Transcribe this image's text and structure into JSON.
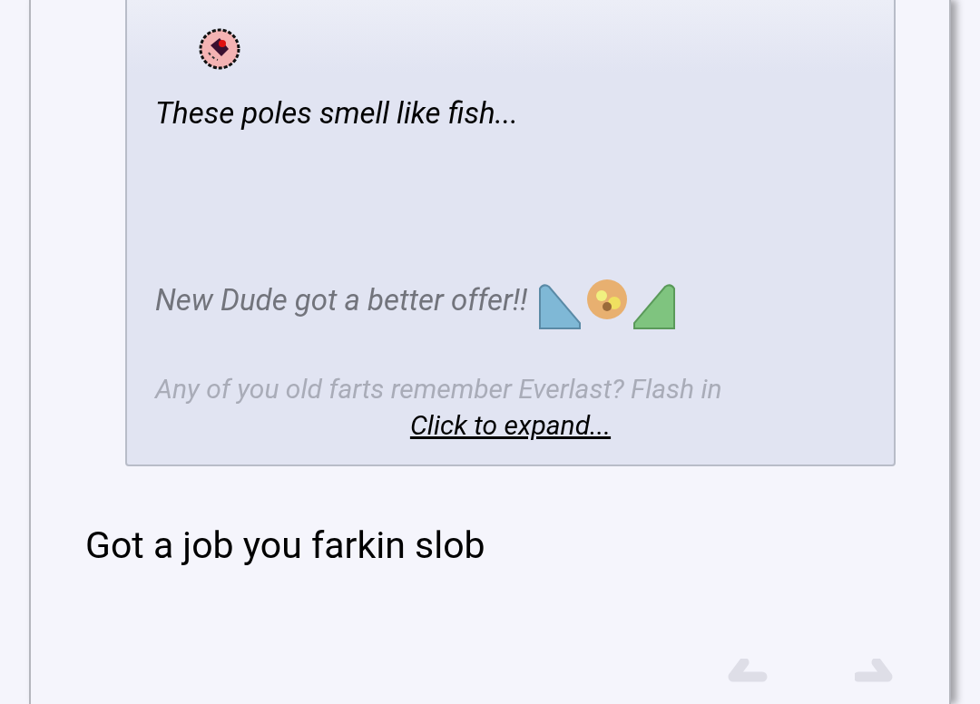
{
  "quote": {
    "lines": [
      {
        "text": "These poles smell like fish...",
        "kind": "normal",
        "emote": false
      },
      {
        "text": "New Dude got a better offer!!",
        "kind": "muted",
        "emote": true
      },
      {
        "text": "Any of you old farts remember Everlast? Flash in",
        "kind": "faded",
        "emote": false
      }
    ],
    "expand_link": "Click to expand..."
  },
  "post_text": "Got a job you farkin slob"
}
